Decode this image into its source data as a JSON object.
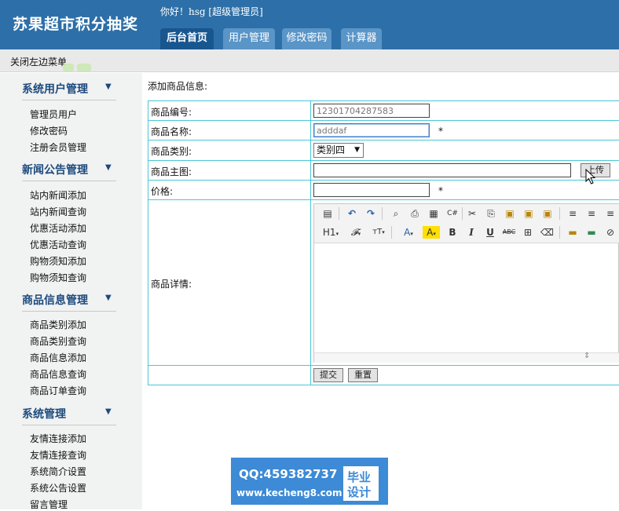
{
  "header": {
    "site_title": "苏果超市积分抽奖",
    "greeting": "你好！hsg [超级管理员]",
    "tabs": [
      {
        "label": "后台首页",
        "active": true
      },
      {
        "label": "用户管理",
        "active": false
      },
      {
        "label": "修改密码",
        "active": false
      },
      {
        "label": "计算器",
        "active": false
      }
    ]
  },
  "subbar": {
    "close_left_menu": "关闭左边菜单"
  },
  "sidebar": {
    "sections": [
      {
        "title": "系统用户管理",
        "items": [
          "管理员用户",
          "修改密码",
          "注册会员管理"
        ]
      },
      {
        "title": "新闻公告管理",
        "items": [
          "站内新闻添加",
          "站内新闻查询",
          "优惠活动添加",
          "优惠活动查询",
          "购物须知添加",
          "购物须知查询"
        ]
      },
      {
        "title": "商品信息管理",
        "items": [
          "商品类别添加",
          "商品类别查询",
          "商品信息添加",
          "商品信息查询",
          "商品订单查询"
        ]
      },
      {
        "title": "系统管理",
        "items": [
          "友情连接添加",
          "友情连接查询",
          "系统简介设置",
          "系统公告设置",
          "留言管理"
        ]
      }
    ]
  },
  "form": {
    "caption": "添加商品信息:",
    "labels": {
      "code": "商品编号:",
      "name": "商品名称:",
      "category": "商品类别:",
      "image": "商品主图:",
      "price": "价格:",
      "detail": "商品详情:"
    },
    "values": {
      "code": "12301704287583",
      "name": "adddaf",
      "category": "类别四",
      "image": "",
      "price": ""
    },
    "required_mark": "*",
    "upload_button": "上传",
    "submit_button": "提交",
    "reset_button": "重置"
  },
  "editor": {
    "heading_label": "H1",
    "font_size_label": "тT",
    "bold": "B",
    "italic": "I",
    "underline": "U",
    "strike_label": "ABC"
  },
  "watermark": {
    "qq": "QQ:459382737",
    "url": "www.kecheng8.com",
    "badge_line1": "毕业",
    "badge_line2": "设计"
  },
  "colors": {
    "header_bg": "#2d6fa8",
    "tab_active": "#18568f",
    "tab_inactive": "#5a95c8",
    "table_border": "#4bc7d8",
    "sidebar_title": "#1c4a7d"
  }
}
